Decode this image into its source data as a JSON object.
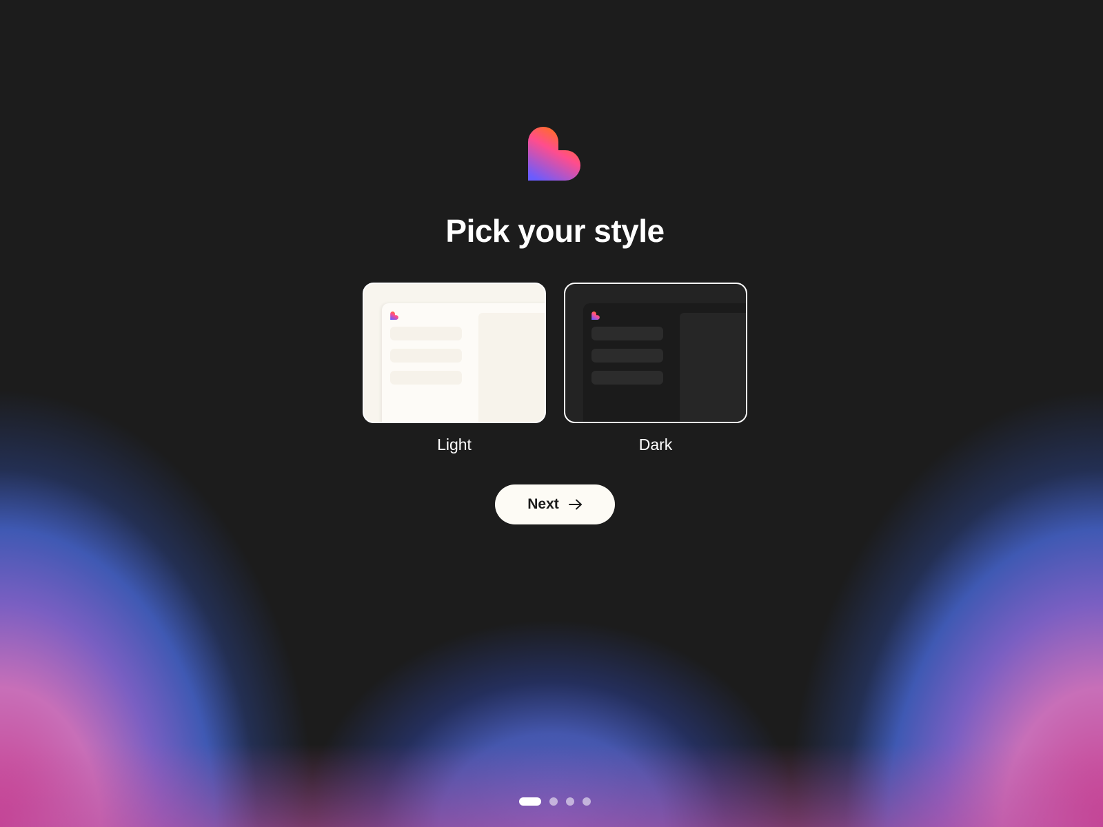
{
  "onboarding": {
    "title": "Pick your style",
    "options": [
      {
        "id": "light",
        "label": "Light",
        "selected": false
      },
      {
        "id": "dark",
        "label": "Dark",
        "selected": true
      }
    ],
    "next_label": "Next",
    "pager": {
      "total": 4,
      "current": 1
    }
  },
  "icons": {
    "logo": "heart-logo-icon",
    "next_arrow": "arrow-right-icon"
  },
  "colors": {
    "background": "#1c1c1c",
    "logo_gradient_top": "#ff7a00",
    "logo_gradient_mid": "#ff4d8d",
    "logo_gradient_bottom": "#6a5cff",
    "glow_pink": "#c93a8c",
    "glow_blue": "#3f59b3",
    "button_bg": "#fdfbf5",
    "light_card": "#f8f5ee",
    "dark_card": "#232323"
  }
}
